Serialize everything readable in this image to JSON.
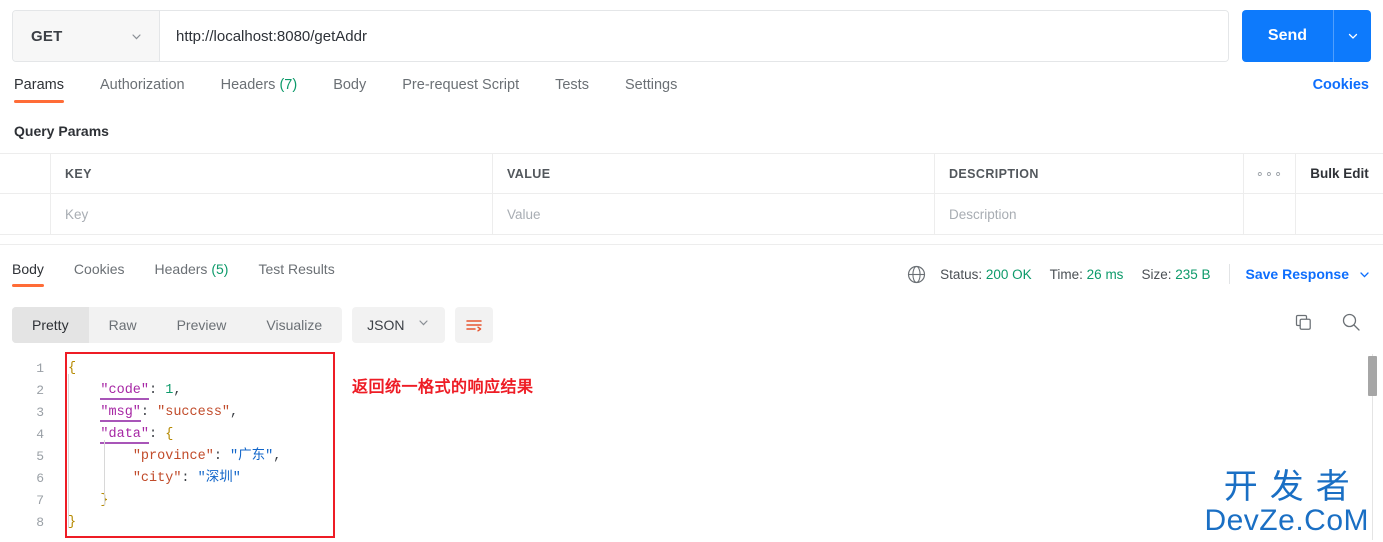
{
  "request": {
    "method": "GET",
    "method_caret_icon": "chevron-down-icon",
    "url": "http://localhost:8080/getAddr",
    "send_label": "Send",
    "send_caret_icon": "chevron-down-icon",
    "tabs": [
      {
        "label": "Params",
        "count": "",
        "active": true
      },
      {
        "label": "Authorization",
        "count": "",
        "active": false
      },
      {
        "label": "Headers ",
        "count": "(7)",
        "active": false
      },
      {
        "label": "Body",
        "count": "",
        "active": false
      },
      {
        "label": "Pre-request Script",
        "count": "",
        "active": false
      },
      {
        "label": "Tests",
        "count": "",
        "active": false
      },
      {
        "label": "Settings",
        "count": "",
        "active": false
      }
    ],
    "cookies_link": "Cookies"
  },
  "query_params": {
    "title": "Query Params",
    "headers": {
      "key": "KEY",
      "value": "VALUE",
      "description": "DESCRIPTION"
    },
    "dots_icon": "more-options-icon",
    "bulk_edit": "Bulk Edit",
    "placeholders": {
      "key": "Key",
      "value": "Value",
      "description": "Description"
    }
  },
  "response": {
    "tabs": [
      {
        "label": "Body",
        "count": "",
        "active": true
      },
      {
        "label": "Cookies",
        "count": "",
        "active": false
      },
      {
        "label": "Headers ",
        "count": "(5)",
        "active": false
      },
      {
        "label": "Test Results",
        "count": "",
        "active": false
      }
    ],
    "globe_icon": "globe-icon",
    "status_label": "Status:",
    "status_value": "200 OK",
    "time_label": "Time:",
    "time_value": "26 ms",
    "size_label": "Size:",
    "size_value": "235 B",
    "save_response": "Save Response",
    "save_caret_icon": "chevron-down-icon",
    "view_modes": [
      {
        "label": "Pretty",
        "active": true
      },
      {
        "label": "Raw",
        "active": false
      },
      {
        "label": "Preview",
        "active": false
      },
      {
        "label": "Visualize",
        "active": false
      }
    ],
    "format": "JSON",
    "format_caret_icon": "chevron-down-icon",
    "wrap_icon": "wrap-lines-icon",
    "copy_icon": "copy-icon",
    "search_icon": "search-icon"
  },
  "json_body": {
    "line_numbers": [
      "1",
      "2",
      "3",
      "4",
      "5",
      "6",
      "7",
      "8"
    ],
    "lines": [
      {
        "n": 1,
        "tokens": [
          {
            "t": "{",
            "c": "brc"
          }
        ]
      },
      {
        "n": 2,
        "tokens": [
          {
            "t": "    ",
            "c": "p"
          },
          {
            "t": "\"code\"",
            "c": "k"
          },
          {
            "t": ": ",
            "c": "p"
          },
          {
            "t": "1",
            "c": "num"
          },
          {
            "t": ",",
            "c": "p"
          }
        ]
      },
      {
        "n": 3,
        "tokens": [
          {
            "t": "    ",
            "c": "p"
          },
          {
            "t": "\"msg\"",
            "c": "k"
          },
          {
            "t": ": ",
            "c": "p"
          },
          {
            "t": "\"success\"",
            "c": "str"
          },
          {
            "t": ",",
            "c": "p"
          }
        ]
      },
      {
        "n": 4,
        "tokens": [
          {
            "t": "    ",
            "c": "p"
          },
          {
            "t": "\"data\"",
            "c": "k"
          },
          {
            "t": ": ",
            "c": "p"
          },
          {
            "t": "{",
            "c": "brc"
          }
        ]
      },
      {
        "n": 5,
        "tokens": [
          {
            "t": "        ",
            "c": "p"
          },
          {
            "t": "\"province\"",
            "c": "str"
          },
          {
            "t": ": ",
            "c": "p"
          },
          {
            "t": "\"广东\"",
            "c": "strz"
          },
          {
            "t": ",",
            "c": "p"
          }
        ]
      },
      {
        "n": 6,
        "tokens": [
          {
            "t": "        ",
            "c": "p"
          },
          {
            "t": "\"city\"",
            "c": "str"
          },
          {
            "t": ": ",
            "c": "p"
          },
          {
            "t": "\"深圳\"",
            "c": "strz"
          }
        ]
      },
      {
        "n": 7,
        "tokens": [
          {
            "t": "    ",
            "c": "p"
          },
          {
            "t": "}",
            "c": "brc"
          }
        ]
      },
      {
        "n": 8,
        "tokens": [
          {
            "t": "}",
            "c": "brc"
          }
        ]
      }
    ],
    "raw": "{\n    \"code\": 1,\n    \"msg\": \"success\",\n    \"data\": {\n        \"province\": \"广东\",\n        \"city\": \"深圳\"\n    }\n}"
  },
  "annotation": {
    "text": "返回统一格式的响应结果",
    "color": "#ee1c25"
  },
  "watermark": {
    "cn": "开发者",
    "en": "DevZe.CoM",
    "color": "#1a6fc4"
  },
  "colors": {
    "accent_orange": "#ff6c37",
    "primary_blue": "#0d7afc",
    "link_blue": "#0d6efd",
    "success_green": "#0d9a6a",
    "annotation_red": "#ee1c25"
  }
}
